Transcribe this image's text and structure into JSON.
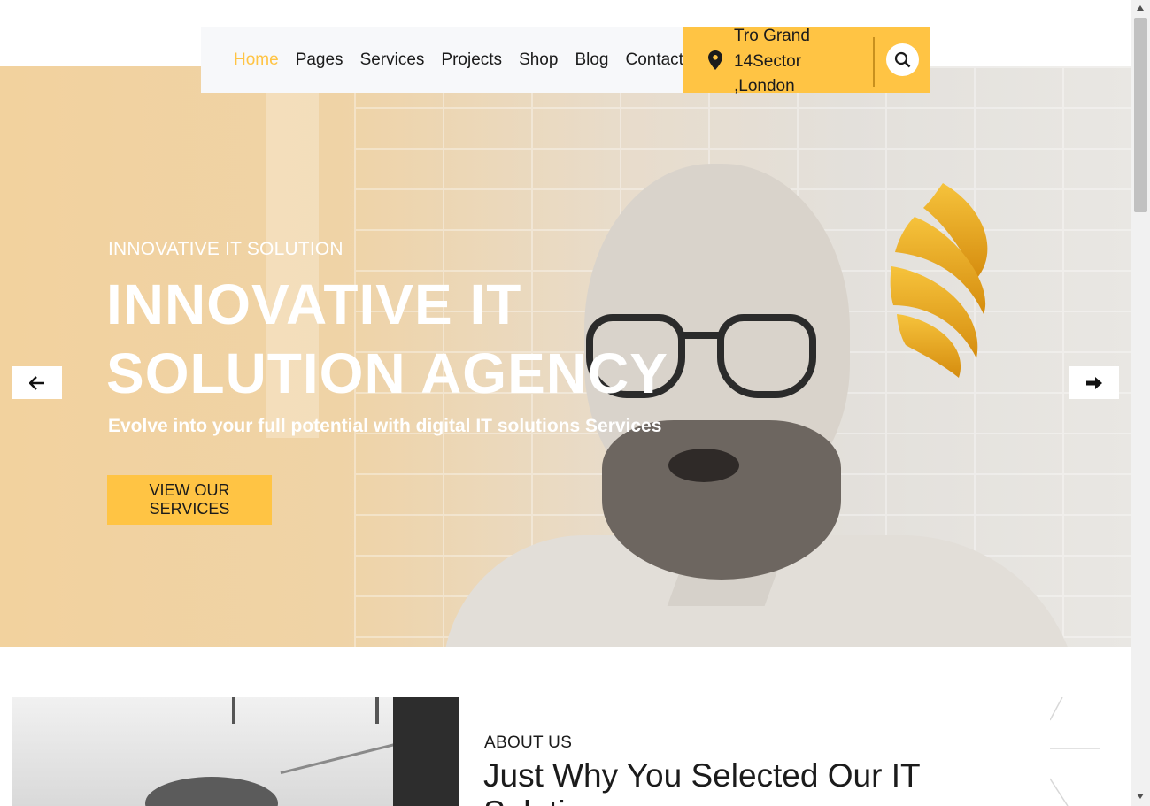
{
  "nav": {
    "items": [
      {
        "label": "Home",
        "active": true
      },
      {
        "label": "Pages",
        "active": false
      },
      {
        "label": "Services",
        "active": false
      },
      {
        "label": "Projects",
        "active": false
      },
      {
        "label": "Shop",
        "active": false
      },
      {
        "label": "Blog",
        "active": false
      },
      {
        "label": "Contact",
        "active": false
      }
    ],
    "address_lines": [
      "Tro Grand",
      "14Sector",
      ",London"
    ],
    "search_icon": "search-icon",
    "location_icon": "map-pin-icon"
  },
  "hero": {
    "subtitle": "INNOVATIVE IT SOLUTION",
    "title_line1": "INNOVATIVE IT",
    "title_line2": "SOLUTION AGENCY",
    "description": "Evolve into your full potential with digital IT solutions Services",
    "cta_label": "VIEW OUR SERVICES",
    "prev_icon": "arrow-left-icon",
    "next_icon": "arrow-right-icon"
  },
  "about": {
    "label": "ABOUT US",
    "title": "Just Why You Selected Our IT Solutions"
  },
  "colors": {
    "accent": "#ffc444",
    "text": "#1b1b1b",
    "nav_bg": "#f7f8fa"
  }
}
